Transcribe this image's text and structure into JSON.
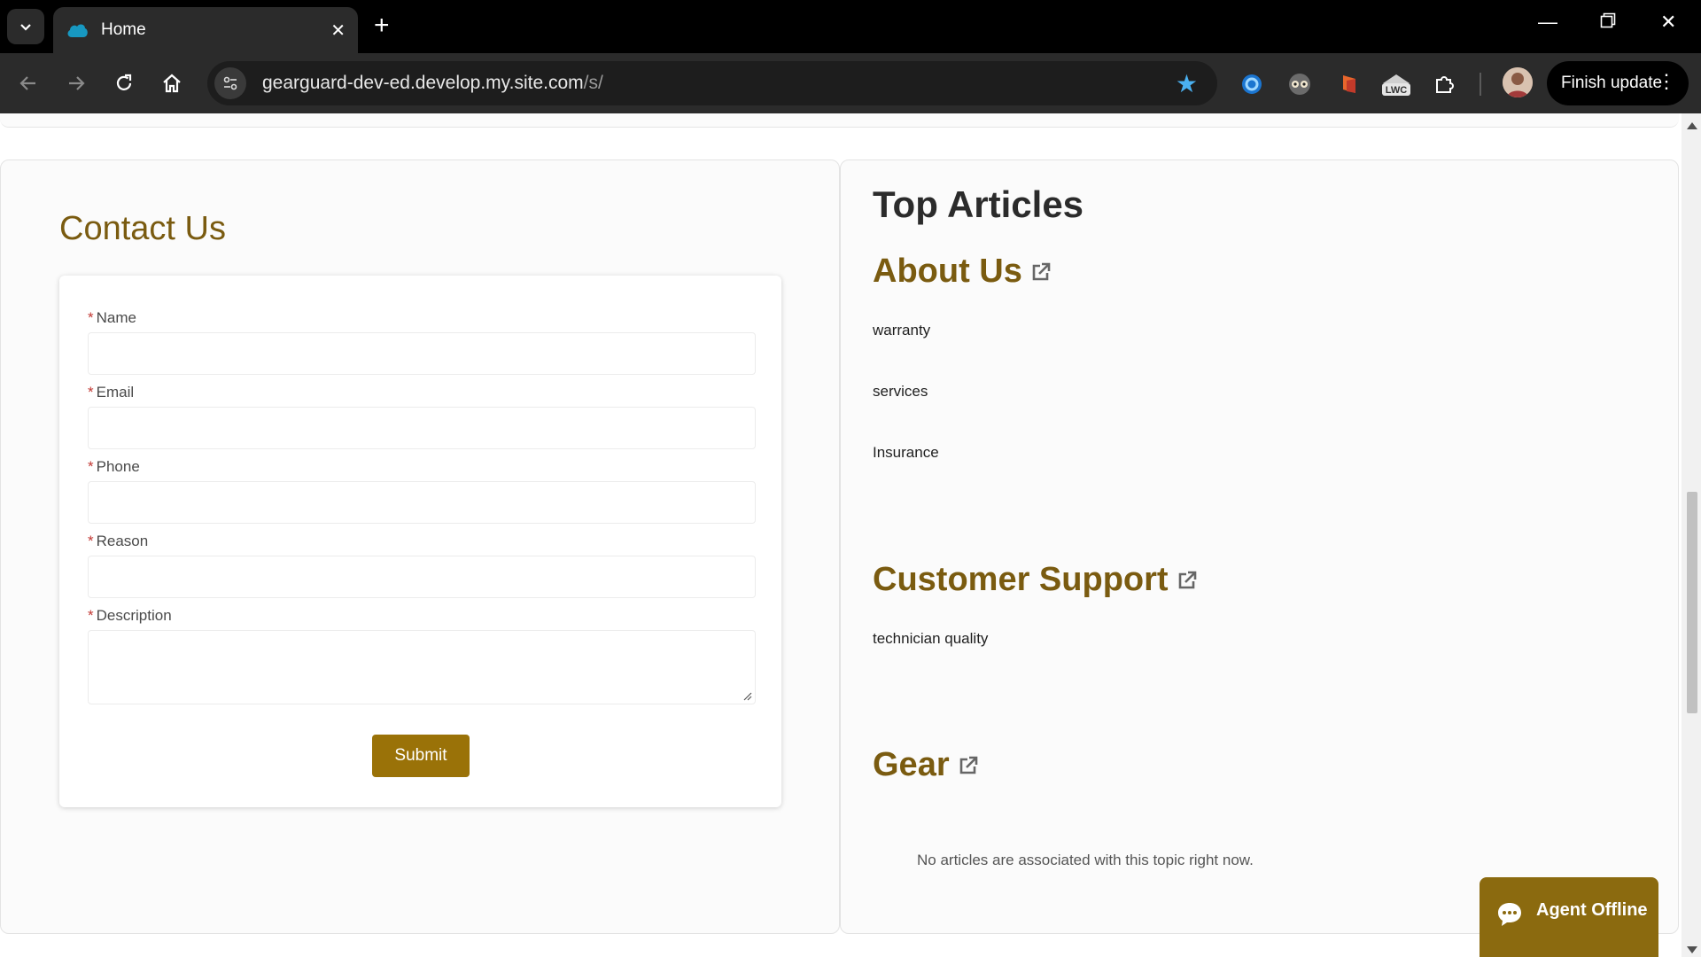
{
  "browser": {
    "tab_title": "Home",
    "url_host": "gearguard-dev-ed.develop.my.site.com",
    "url_path": "/s/",
    "finish_update_label": "Finish update",
    "extensions": [
      "salesforce-inspector-icon",
      "glasses-extension-icon",
      "flag-extension-icon",
      "lwc-extension-icon",
      "extensions-puzzle-icon"
    ],
    "lwc_badge": "LWC"
  },
  "contact": {
    "title": "Contact Us",
    "fields": [
      {
        "label": "Name",
        "required_mark": "*"
      },
      {
        "label": "Email",
        "required_mark": "*"
      },
      {
        "label": "Phone",
        "required_mark": "*"
      },
      {
        "label": "Reason",
        "required_mark": "*"
      },
      {
        "label": "Description",
        "required_mark": "*"
      }
    ],
    "submit_label": "Submit"
  },
  "articles": {
    "title": "Top Articles",
    "topics": [
      {
        "name": "About Us",
        "articles": [
          "warranty",
          "services",
          "Insurance"
        ]
      },
      {
        "name": "Customer Support",
        "articles": [
          "technician quality"
        ]
      },
      {
        "name": "Gear",
        "articles": [],
        "empty_text": "No articles are associated with this topic right now."
      }
    ]
  },
  "chat": {
    "label": "Agent Offline"
  },
  "colors": {
    "brand": "#7a5b10",
    "button": "#9a7208",
    "chat": "#8b6a0f",
    "required": "#c23934"
  }
}
